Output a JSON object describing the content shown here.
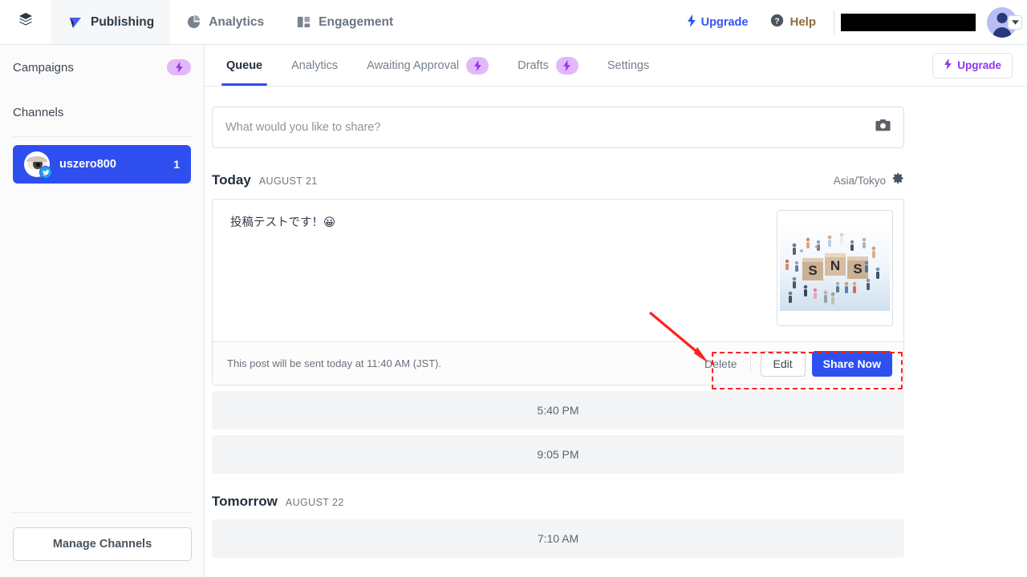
{
  "topbar": {
    "logo_icon": "layers-icon",
    "nav": [
      {
        "label": "Publishing",
        "icon": "publishing-icon",
        "active": true
      },
      {
        "label": "Analytics",
        "icon": "pie-chart-icon",
        "active": false
      },
      {
        "label": "Engagement",
        "icon": "engagement-icon",
        "active": false
      }
    ],
    "upgrade_label": "Upgrade",
    "upgrade_icon": "bolt-icon",
    "help_label": "Help",
    "help_icon": "question-circle-icon",
    "account_redacted": "",
    "avatar_icon": "user-avatar",
    "caret_icon": "chevron-down-icon"
  },
  "sidebar": {
    "campaigns_label": "Campaigns",
    "campaigns_badge_icon": "bolt-icon",
    "channels_label": "Channels",
    "channel": {
      "name": "uszero800",
      "count": "1",
      "avatar_icon": "eye-avatar",
      "network_icon": "twitter-icon"
    },
    "manage_button": "Manage Channels"
  },
  "tabs": [
    {
      "label": "Queue",
      "badge": null,
      "active": true
    },
    {
      "label": "Analytics",
      "badge": null,
      "active": false
    },
    {
      "label": "Awaiting Approval",
      "badge": "bolt-icon",
      "active": false
    },
    {
      "label": "Drafts",
      "badge": "bolt-icon",
      "active": false
    },
    {
      "label": "Settings",
      "badge": null,
      "active": false
    }
  ],
  "tabbar": {
    "upgrade_label": "Upgrade",
    "upgrade_icon": "bolt-icon"
  },
  "composer": {
    "placeholder": "What would you like to share?",
    "value": "",
    "camera_icon": "camera-icon"
  },
  "schedule": {
    "today": {
      "title": "Today",
      "date": "AUGUST 21",
      "timezone": "Asia/Tokyo",
      "timezone_icon": "gear-icon"
    },
    "post": {
      "text": "投稿テストです！😀",
      "thumbnail_alt": "SNS wooden blocks with miniature figures",
      "note": "This post will be sent today at 11:40 AM (JST).",
      "delete_label": "Delete",
      "edit_label": "Edit",
      "share_label": "Share Now"
    },
    "today_slots": [
      "5:40 PM",
      "9:05 PM"
    ],
    "tomorrow": {
      "title": "Tomorrow",
      "date": "AUGUST 22"
    },
    "tomorrow_slots": [
      "7:10 AM"
    ]
  },
  "colors": {
    "brand_blue": "#2f50f0",
    "pro_purple": "#9333ea",
    "pro_pill": "#e3b8fb",
    "annotation_red": "#ff1f1f",
    "twitter_blue": "#1da1f2"
  }
}
